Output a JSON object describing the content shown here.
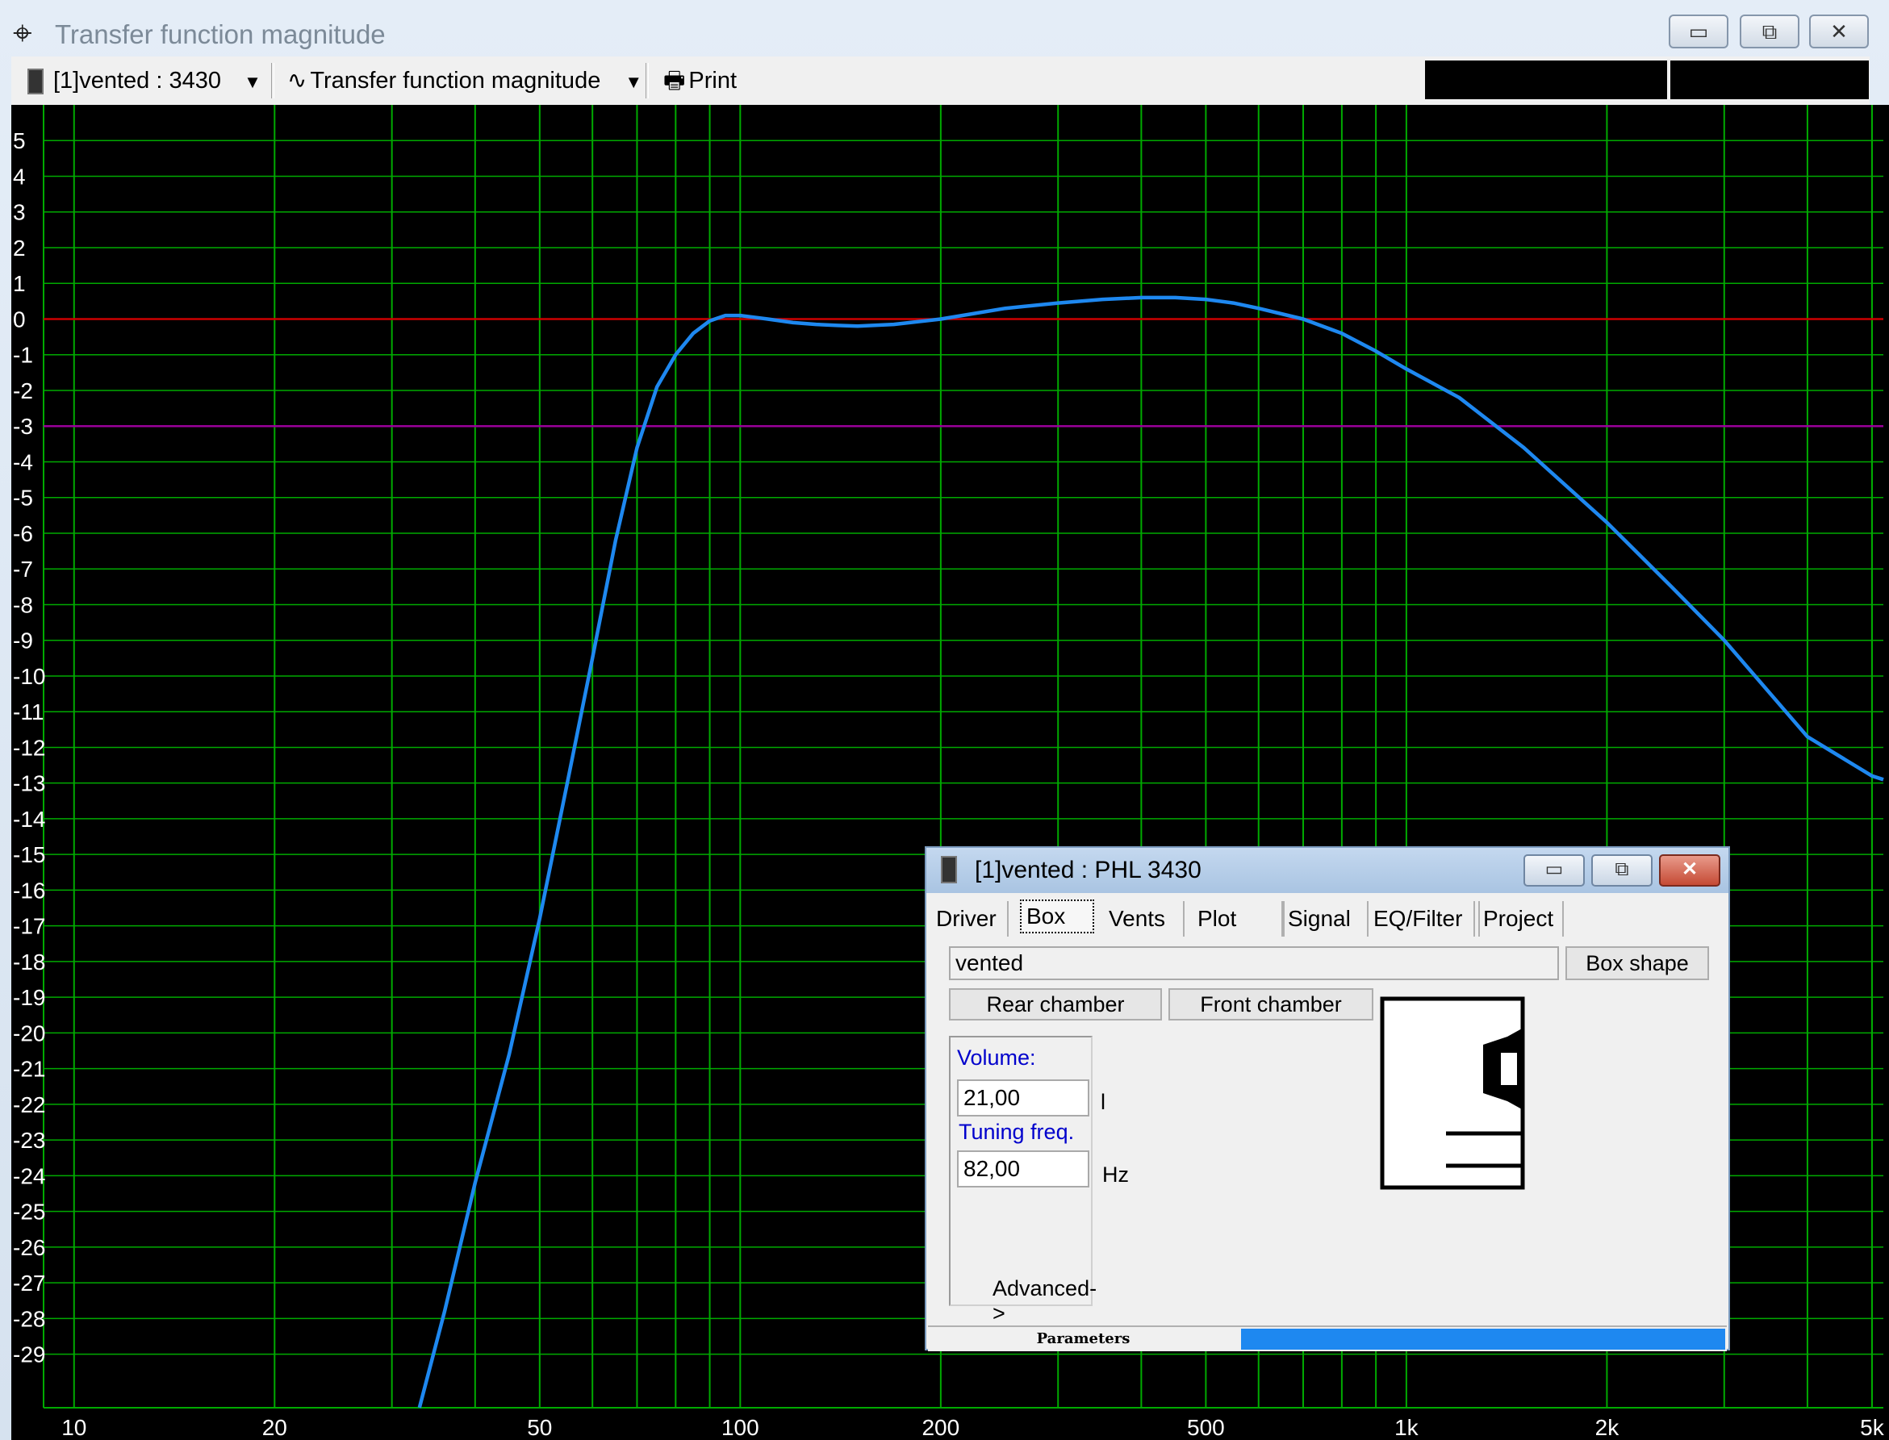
{
  "window": {
    "title": "Transfer function magnitude",
    "icon": "crosshair-icon",
    "controls": [
      "minimize-icon",
      "restore-icon",
      "close-icon"
    ]
  },
  "toolbar": {
    "project_selector": "[1]vented : 3430",
    "plot_selector": "Transfer function magnitude",
    "print_label": "Print",
    "icons": [
      "speaker-icon",
      "chevron-down-icon",
      "waveform-icon",
      "printer-icon"
    ]
  },
  "chart_data": {
    "type": "line",
    "xscale": "log",
    "xlim": [
      9,
      5200
    ],
    "ylim": [
      -30.5,
      6
    ],
    "x_tick_labels": [
      {
        "v": 10,
        "t": "10"
      },
      {
        "v": 20,
        "t": "20"
      },
      {
        "v": 50,
        "t": "50"
      },
      {
        "v": 100,
        "t": "100"
      },
      {
        "v": 200,
        "t": "200"
      },
      {
        "v": 500,
        "t": "500"
      },
      {
        "v": 1000,
        "t": "1k"
      },
      {
        "v": 2000,
        "t": "2k"
      },
      {
        "v": 5000,
        "t": "5k"
      }
    ],
    "y_tick_labels": [
      "5",
      "4",
      "3",
      "2",
      "1",
      "0",
      "-1",
      "-2",
      "-3",
      "-4",
      "-5",
      "-6",
      "-7",
      "-8",
      "-9",
      "-10",
      "-11",
      "-12",
      "-13",
      "-14",
      "-15",
      "-16",
      "-17",
      "-18",
      "-19",
      "-20",
      "-21",
      "-22",
      "-23",
      "-24",
      "-25",
      "-26",
      "-27",
      "-28",
      "-29"
    ],
    "y_ticks": [
      5,
      4,
      3,
      2,
      1,
      0,
      -1,
      -2,
      -3,
      -4,
      -5,
      -6,
      -7,
      -8,
      -9,
      -10,
      -11,
      -12,
      -13,
      -14,
      -15,
      -16,
      -17,
      -18,
      -19,
      -20,
      -21,
      -22,
      -23,
      -24,
      -25,
      -26,
      -27,
      -28,
      -29
    ],
    "reference_lines": [
      {
        "y": 0,
        "color": "#cc0000"
      },
      {
        "y": -3,
        "color": "#990099"
      }
    ],
    "grid": true,
    "grid_color": "#00aa00",
    "background": "#000000",
    "series": [
      {
        "color": "#1e88f0",
        "x": [
          33,
          36,
          40,
          45,
          50,
          55,
          60,
          65,
          70,
          75,
          80,
          85,
          90,
          95,
          100,
          105,
          110,
          120,
          130,
          140,
          150,
          170,
          200,
          250,
          300,
          350,
          400,
          450,
          500,
          550,
          600,
          700,
          800,
          900,
          1000,
          1200,
          1500,
          2000,
          2500,
          3000,
          4000,
          5000,
          5200
        ],
        "y": [
          -30.5,
          -27.8,
          -24.2,
          -20.6,
          -16.8,
          -13,
          -9.5,
          -6.2,
          -3.6,
          -1.9,
          -1,
          -0.4,
          -0.05,
          0.1,
          0.1,
          0.05,
          0,
          -0.1,
          -0.15,
          -0.18,
          -0.2,
          -0.15,
          0,
          0.3,
          0.45,
          0.55,
          0.6,
          0.6,
          0.55,
          0.45,
          0.3,
          0,
          -0.4,
          -0.9,
          -1.4,
          -2.2,
          -3.6,
          -5.7,
          -7.5,
          -9,
          -11.7,
          -12.8,
          -12.9
        ]
      }
    ]
  },
  "dialog": {
    "title": "[1]vented : PHL 3430",
    "icon": "speaker-icon",
    "controls": [
      "minimize-icon",
      "restore-icon",
      "close-icon"
    ],
    "tabs": [
      "Driver",
      "Box",
      "Vents",
      "Plot",
      "Signal",
      "EQ/Filter",
      "Project"
    ],
    "active_tab": "Box",
    "box_type": "vented",
    "box_shape_button": "Box shape",
    "rear_chamber_button": "Rear chamber",
    "front_chamber_button": "Front chamber",
    "volume_label": "Volume:",
    "volume_value": "21,00",
    "volume_unit": "l",
    "tuning_label": "Tuning freq.",
    "tuning_value": "82,00",
    "tuning_unit": "Hz",
    "advanced_button": "Advanced->",
    "status_label": "Parameters",
    "status_progress": 1.0,
    "preview_icon": "vented-box-diagram-icon"
  }
}
